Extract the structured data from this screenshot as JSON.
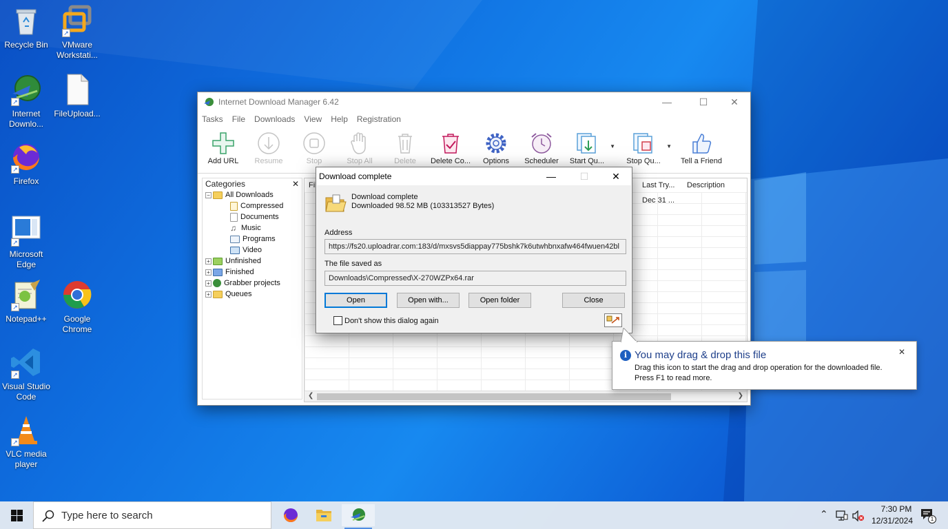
{
  "desktop": {
    "icons": [
      {
        "label": "Recycle Bin"
      },
      {
        "label": "VMware Workstati..."
      },
      {
        "label": "Internet Downlo..."
      },
      {
        "label": "FileUpload..."
      },
      {
        "label": "Firefox"
      },
      {
        "label": "Microsoft Edge"
      },
      {
        "label": "Notepad++"
      },
      {
        "label": "Google Chrome"
      },
      {
        "label": "Visual Studio Code"
      },
      {
        "label": "VLC media player"
      }
    ]
  },
  "idm": {
    "title": "Internet Download Manager 6.42",
    "menu": [
      "Tasks",
      "File",
      "Downloads",
      "View",
      "Help",
      "Registration"
    ],
    "toolbar": [
      "Add URL",
      "Resume",
      "Stop",
      "Stop All",
      "Delete",
      "Delete Co...",
      "Options",
      "Scheduler",
      "Start Qu...",
      "Stop Qu...",
      "Tell a Friend"
    ],
    "categories_header": "Categories",
    "tree": [
      "All Downloads",
      "Compressed",
      "Documents",
      "Music",
      "Programs",
      "Video",
      "Unfinished",
      "Finished",
      "Grabber projects",
      "Queues"
    ],
    "columns": {
      "file": "Fil",
      "last_try": "Last Try...",
      "description": "Description"
    },
    "row": {
      "last_try": "Dec 31 ..."
    }
  },
  "dialog": {
    "title": "Download complete",
    "status": "Download complete",
    "downloaded": "Downloaded 98.52  MB (103313527 Bytes)",
    "address_label": "Address",
    "address": "https://fs20.uploadrar.com:183/d/mxsvs5diappay775bshk7k6utwhbnxafw464fwuen42bl",
    "saved_label": "The file saved as",
    "saved_path": "Downloads\\Compressed\\X-270WZPx64.rar",
    "buttons": {
      "open": "Open",
      "open_with": "Open with...",
      "open_folder": "Open folder",
      "close": "Close"
    },
    "checkbox": "Don't show this dialog again"
  },
  "balloon": {
    "title": "You may drag & drop this file",
    "line1": "Drag this icon to start the drag and drop operation for the downloaded file.",
    "line2": "Press F1 to read more."
  },
  "taskbar": {
    "search_placeholder": "Type here to search",
    "time": "7:30 PM",
    "date": "12/31/2024",
    "notification_count": "1"
  }
}
